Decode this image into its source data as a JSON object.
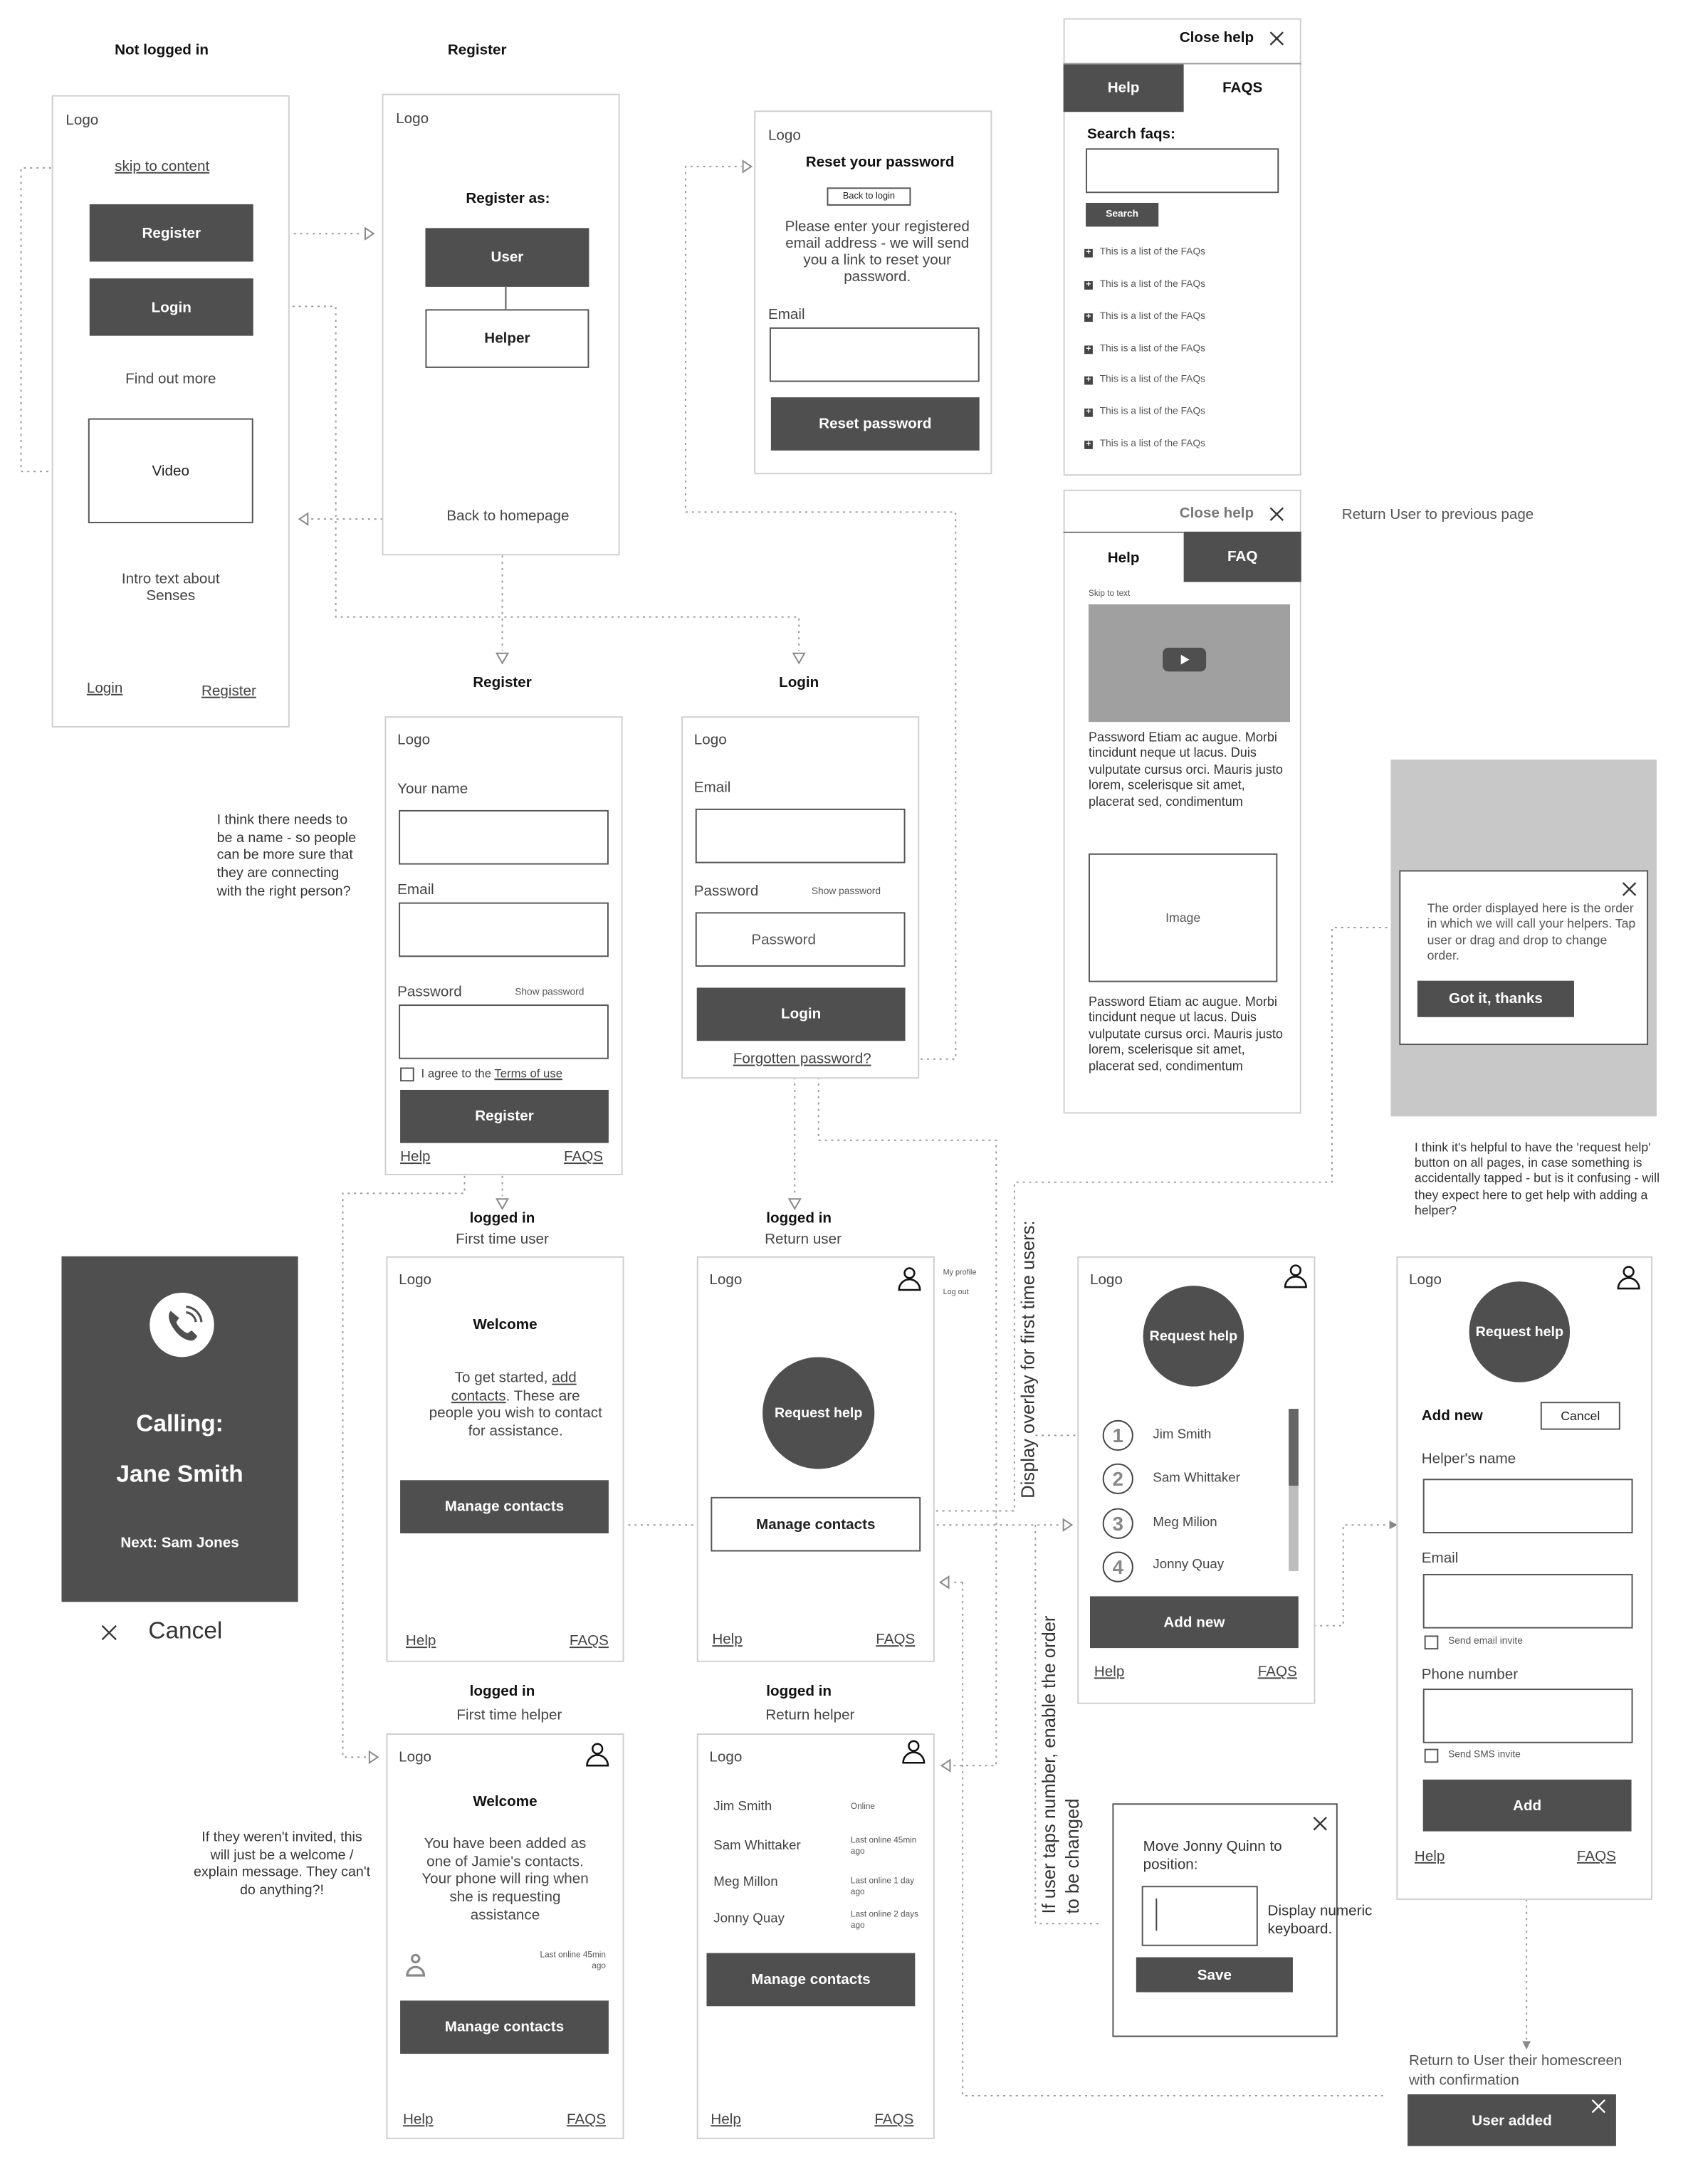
{
  "labels": {
    "not_logged_in": "Not logged in",
    "register_top": "Register",
    "register": "Register",
    "login": "Login",
    "logged_in": "logged in",
    "first_time_user": "First time user",
    "return_user": "Return user",
    "first_time_helper": "First time helper",
    "return_helper": "Return helper"
  },
  "home": {
    "logo": "Logo",
    "skip": "skip to content",
    "register_btn": "Register",
    "login_btn": "Login",
    "find_out": "Find out more",
    "video": "Video",
    "intro": "Intro text about Senses",
    "footer_login": "Login",
    "footer_register": "Register"
  },
  "register_as": {
    "logo": "Logo",
    "title": "Register as:",
    "user": "User",
    "helper": "Helper",
    "back": "Back to homepage"
  },
  "reset": {
    "logo": "Logo",
    "title": "Reset your password",
    "back": "Back to login",
    "text": "Please enter your registered email address - we will send you a link to reset your password.",
    "email_label": "Email",
    "email_value": "",
    "button": "Reset password"
  },
  "faq_panel": {
    "close": "Close help",
    "tab_help": "Help",
    "tab_faqs": "FAQS",
    "search_label": "Search faqs:",
    "search_value": "",
    "search_btn": "Search",
    "items": [
      "This is a list of the FAQs",
      "This is a list of the FAQs",
      "This is a list of the FAQs",
      "This is a list of the FAQs",
      "This is a list of the FAQs",
      "This is a list of the FAQs",
      "This is a list of the FAQs"
    ]
  },
  "help_panel": {
    "close": "Close help",
    "tab_help": "Help",
    "tab_faq": "FAQ",
    "skip": "Skip to text",
    "para1": "Password Etiam ac augue. Morbi tincidunt neque ut lacus. Duis vulputate cursus orci. Mauris justo lorem, scelerisque sit amet, placerat sed, condimentum",
    "image": "Image",
    "para2": "Password Etiam ac augue. Morbi tincidunt neque ut lacus. Duis vulputate cursus orci. Mauris justo lorem, scelerisque sit amet, placerat sed, condimentum"
  },
  "notes": {
    "return_prev": "Return User to previous page",
    "name_note": "I think there needs to be a name - so people can be more sure that they are connecting with the right person?",
    "request_help_note": "I think it's helpful to have the 'request help' button on all pages, in case something is accidentally tapped - but is it confusing - will they expect here to get help with adding a helper?",
    "helper_note": "If they weren't invited, this will just be a welcome / explain message. They can't do anything?!",
    "overlay_note": "Display overlay for first time users:",
    "order_note_1": "If user taps number, enable the order",
    "order_note_2": "to be changed",
    "numeric_note": "Display numeric keyboard.",
    "return_home": "Return to User their homescreen with confirmation"
  },
  "overlay": {
    "text": "The order displayed here is the order in which we will call your helpers. Tap user or drag and drop to change order.",
    "button": "Got it, thanks"
  },
  "register_form": {
    "logo": "Logo",
    "name_label": "Your name",
    "name_value": "",
    "email_label": "Email",
    "email_value": "",
    "password_label": "Password",
    "show_password": "Show password",
    "password_value": "",
    "agree_pre": "I agree to the ",
    "agree_link": "Terms of use",
    "agree_checked": false,
    "button": "Register",
    "help": "Help",
    "faqs": "FAQS"
  },
  "login_form": {
    "logo": "Logo",
    "email_label": "Email",
    "email_value": "",
    "password_label": "Password",
    "show_password": "Show password",
    "password_placeholder": "Password",
    "button": "Login",
    "forgot": "Forgotten password?"
  },
  "calling": {
    "title": "Calling:",
    "name": "Jane Smith",
    "next": "Next: Sam Jones",
    "cancel": "Cancel"
  },
  "user_welcome": {
    "logo": "Logo",
    "title": "Welcome",
    "text_pre": "To get started, ",
    "link": "add contacts",
    "text_post": ". These are people you wish to contact for assistance.",
    "button": "Manage contacts",
    "help": "Help",
    "faqs": "FAQS"
  },
  "user_home": {
    "logo": "Logo",
    "request": "Request help",
    "button": "Manage contacts",
    "help": "Help",
    "faqs": "FAQS",
    "menu": [
      "My profile",
      "Log out"
    ]
  },
  "contacts": {
    "logo": "Logo",
    "request": "Request help",
    "list": [
      {
        "n": "1",
        "name": "Jim Smith"
      },
      {
        "n": "2",
        "name": "Sam Whittaker"
      },
      {
        "n": "3",
        "name": "Meg Milion"
      },
      {
        "n": "4",
        "name": "Jonny Quay"
      }
    ],
    "scroll_thumb_fraction": 0.47,
    "add": "Add new",
    "help": "Help",
    "faqs": "FAQS"
  },
  "add_helper": {
    "logo": "Logo",
    "request": "Request help",
    "title": "Add new",
    "cancel": "Cancel",
    "name_label": "Helper's name",
    "name_value": "",
    "email_label": "Email",
    "email_value": "",
    "email_invite": "Send email invite",
    "phone_label": "Phone number",
    "phone_value": "",
    "sms_invite": "Send SMS invite",
    "button": "Add",
    "help": "Help",
    "faqs": "FAQS"
  },
  "helper_welcome": {
    "logo": "Logo",
    "title": "Welcome",
    "text": "You have been added as one of Jamie's contacts. Your phone will ring when she is requesting assistance",
    "last_online": "Last online 45min ago",
    "button": "Manage contacts",
    "help": "Help",
    "faqs": "FAQS"
  },
  "helper_home": {
    "logo": "Logo",
    "rows": [
      {
        "name": "Jim Smith",
        "status": "Online"
      },
      {
        "name": "Sam Whittaker",
        "status": "Last online 45min ago"
      },
      {
        "name": "Meg Millon",
        "status": "Last online 1 day ago"
      },
      {
        "name": "Jonny Quay",
        "status": "Last online 2 days ago"
      }
    ],
    "button": "Manage contacts",
    "help": "Help",
    "faqs": "FAQS"
  },
  "move_dialog": {
    "text": "Move Jonny Quinn to position:",
    "value": "",
    "save": "Save"
  },
  "toast": {
    "text": "User added"
  },
  "colors": {
    "dark": "#4f4f4f",
    "overlay": "#c8c8c8",
    "video": "#a0a0a0",
    "border": "#cfcfcf"
  }
}
